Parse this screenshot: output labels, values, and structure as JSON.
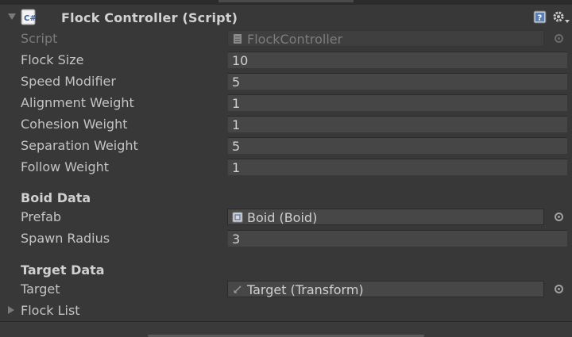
{
  "component": {
    "title": "Flock Controller (Script)",
    "icon": "csharp-script-icon"
  },
  "script_row": {
    "label": "Script",
    "value": "FlockController",
    "icon": "script-file-icon"
  },
  "fields": [
    {
      "label": "Flock Size",
      "value": "10"
    },
    {
      "label": "Speed Modifier",
      "value": "5"
    },
    {
      "label": "Alignment Weight",
      "value": "1"
    },
    {
      "label": "Cohesion Weight",
      "value": "1"
    },
    {
      "label": "Separation Weight",
      "value": "5"
    },
    {
      "label": "Follow Weight",
      "value": "1"
    }
  ],
  "boid_data": {
    "header": "Boid Data",
    "prefab": {
      "label": "Prefab",
      "value": "Boid (Boid)",
      "icon": "prefab-object-icon"
    },
    "spawn_radius": {
      "label": "Spawn Radius",
      "value": "3"
    }
  },
  "target_data": {
    "header": "Target Data",
    "target": {
      "label": "Target",
      "value": "Target (Transform)",
      "icon": "transform-icon"
    }
  },
  "flock_list": {
    "label": "Flock List"
  }
}
